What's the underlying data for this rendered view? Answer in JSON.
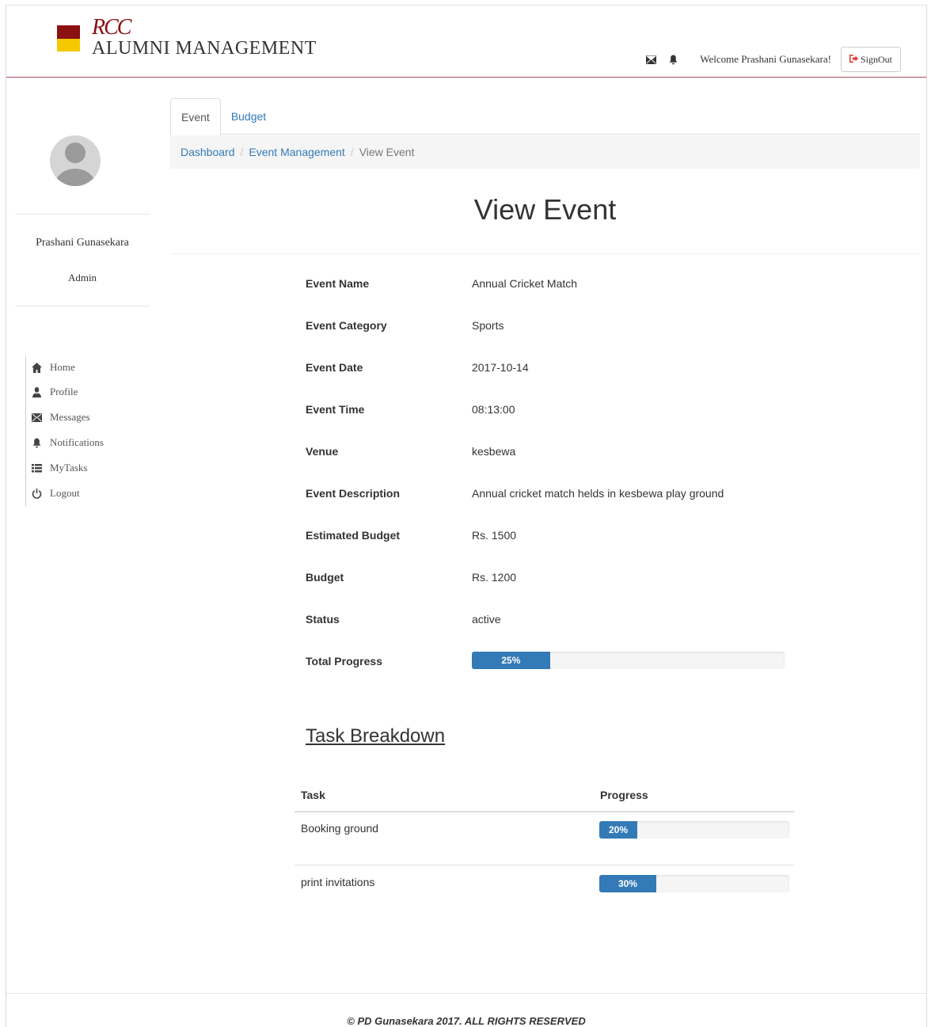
{
  "header": {
    "logo_text_top": "RCC",
    "logo_text_bottom": "ALUMNI MANAGEMENT",
    "messages_icon": "envelope-icon",
    "notifications_icon": "bell-icon",
    "welcome_text": "Welcome Prashani Gunasekara!",
    "signout_label": "SignOut",
    "brand_red": "#8b1012",
    "brand_yellow": "#f5c800"
  },
  "sidebar": {
    "user_name": "Prashani Gunasekara",
    "user_role": "Admin",
    "nav": [
      {
        "label": "Home",
        "icon": "home-icon"
      },
      {
        "label": "Profile",
        "icon": "user-icon"
      },
      {
        "label": "Messages",
        "icon": "envelope-icon"
      },
      {
        "label": "Notifications",
        "icon": "bell-icon"
      },
      {
        "label": "MyTasks",
        "icon": "list-icon"
      },
      {
        "label": "Logout",
        "icon": "power-icon"
      }
    ]
  },
  "tabs": [
    {
      "label": "Event",
      "active": true
    },
    {
      "label": "Budget",
      "active": false
    }
  ],
  "breadcrumb": {
    "items": [
      "Dashboard",
      "Event Management"
    ],
    "current": "View Event"
  },
  "page_title": "View Event",
  "event": {
    "rows": [
      {
        "label": "Event Name",
        "value": "Annual Cricket Match"
      },
      {
        "label": "Event Category",
        "value": "Sports"
      },
      {
        "label": "Event Date",
        "value": "2017-10-14"
      },
      {
        "label": "Event Time",
        "value": "08:13:00"
      },
      {
        "label": "Venue",
        "value": "kesbewa"
      },
      {
        "label": "Event Description",
        "value": "Annual cricket match helds in kesbewa play ground"
      },
      {
        "label": "Estimated Budget",
        "value": "Rs. 1500"
      },
      {
        "label": "Budget",
        "value": "Rs. 1200"
      },
      {
        "label": "Status",
        "value": "active"
      }
    ],
    "total_progress_label": "Total Progress",
    "total_progress": 25,
    "total_progress_text": "25%"
  },
  "task_breakdown": {
    "heading": "Task Breakdown",
    "columns": [
      "Task",
      "Progress"
    ],
    "tasks": [
      {
        "task": "Booking ground",
        "progress": 20,
        "progress_text": "20%"
      },
      {
        "task": "print invitations",
        "progress": 30,
        "progress_text": "30%"
      }
    ]
  },
  "accent_color": "#337ab7",
  "footer": "© PD Gunasekara 2017. ALL RIGHTS RESERVED"
}
